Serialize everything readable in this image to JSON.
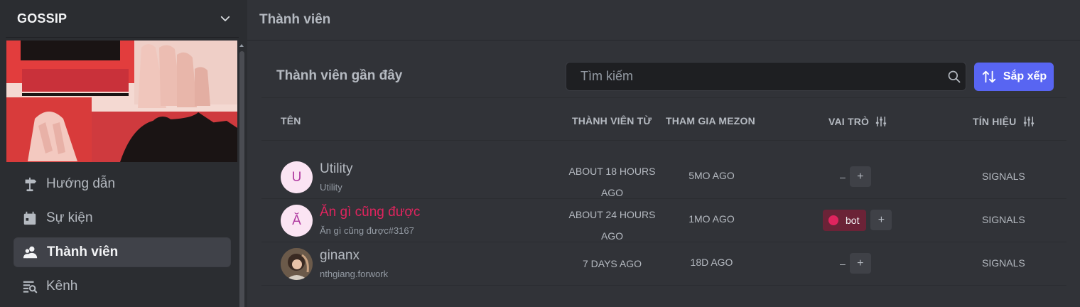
{
  "sidebar": {
    "server_name": "GOSSIP",
    "nav": [
      {
        "label": "Hướng dẫn",
        "icon": "signpost-icon"
      },
      {
        "label": "Sự kiện",
        "icon": "calendar-icon"
      },
      {
        "label": "Thành viên",
        "icon": "members-icon",
        "active": true
      },
      {
        "label": "Kênh",
        "icon": "channel-browse-icon"
      }
    ]
  },
  "main": {
    "title": "Thành viên",
    "panel_title": "Thành viên gần đây",
    "search_placeholder": "Tìm kiếm",
    "sort_label": "Sắp xếp",
    "columns": {
      "name": "TÊN",
      "member_since": "THÀNH VIÊN TỪ",
      "joined": "THAM GIA MEZON",
      "roles": "VAI TRÒ",
      "signals": "TÍN HIỆU"
    },
    "members": [
      {
        "initial": "U",
        "name": "Utility",
        "handle": "Utility",
        "since_1": "ABOUT 18 HOURS",
        "since_2": "AGO",
        "joined": "5MO AGO",
        "roles": "–",
        "signals": "SIGNALS"
      },
      {
        "initial": "Ă",
        "name": "Ăn gì cũng được",
        "handle": "Ăn gì cũng được#3167",
        "since_1": "ABOUT 24 HOURS",
        "since_2": "AGO",
        "joined": "1MO AGO",
        "role_badge": "bot",
        "signals": "SIGNALS"
      },
      {
        "initial": "",
        "name": "ginanx",
        "handle": "nthgiang.forwork",
        "since_1": "7 DAYS AGO",
        "since_2": "",
        "joined": "18D AGO",
        "roles": "–",
        "signals": "SIGNALS"
      }
    ]
  },
  "colors": {
    "accent": "#5865f2",
    "bot_role": "#e0245e",
    "background": "#313338",
    "sidebar": "#2b2d31"
  }
}
